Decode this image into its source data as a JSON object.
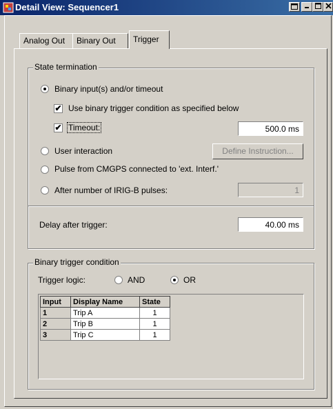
{
  "window": {
    "title": "Detail View: Sequencer1"
  },
  "tabs": [
    {
      "label": "Analog Out"
    },
    {
      "label": "Binary Out"
    },
    {
      "label": "Trigger"
    }
  ],
  "state_termination": {
    "legend": "State termination",
    "binary_input_label": "Binary input(s) and/or timeout",
    "use_binary_trigger_label": "Use binary trigger condition as specified below",
    "timeout_label": "Timeout:",
    "timeout_value": "500.0 ms",
    "user_interaction_label": "User interaction",
    "define_instruction_label": "Define Instruction...",
    "pulse_label": "Pulse from CMGPS connected to 'ext. Interf.'",
    "irig_label": "After number of IRIG-B pulses:",
    "irig_value": "1",
    "delay_label": "Delay after trigger:",
    "delay_value": "40.00 ms"
  },
  "binary_trigger": {
    "legend": "Binary trigger condition",
    "logic_label": "Trigger logic:",
    "and_label": "AND",
    "or_label": "OR",
    "selected": "OR"
  },
  "table": {
    "headers": [
      "Input",
      "Display Name",
      "State"
    ],
    "rows": [
      [
        "1",
        "Trip A",
        "1"
      ],
      [
        "2",
        "Trip B",
        "1"
      ],
      [
        "3",
        "Trip C",
        "1"
      ]
    ]
  }
}
